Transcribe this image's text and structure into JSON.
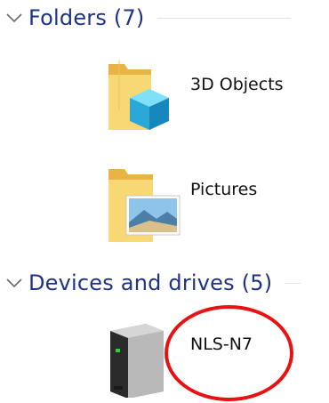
{
  "groups": {
    "folders": {
      "title": "Folders (7)"
    },
    "devices": {
      "title": "Devices and drives (5)"
    }
  },
  "folders": [
    {
      "label": "3D Objects",
      "icon": "3d-objects-folder-icon"
    },
    {
      "label": "Pictures",
      "icon": "pictures-folder-icon"
    }
  ],
  "devices": [
    {
      "label": "NLS-N7",
      "icon": "network-drive-icon"
    }
  ],
  "colors": {
    "group_title": "#1e3287",
    "annotation": "#e81212"
  }
}
